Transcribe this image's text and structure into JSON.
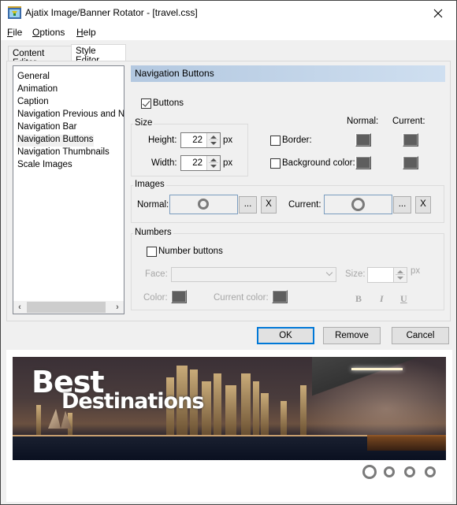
{
  "window": {
    "title": "Ajatix Image/Banner Rotator - [travel.css]",
    "close_icon": "close-x-icon"
  },
  "menu": {
    "items": [
      {
        "label": "File",
        "accel": "F",
        "rest": "ile"
      },
      {
        "label": "Options",
        "accel": "O",
        "rest": "ptions"
      },
      {
        "label": "Help",
        "accel": "H",
        "rest": "elp"
      }
    ]
  },
  "tabs": [
    {
      "label": "Content Editor",
      "active": false
    },
    {
      "label": "Style Editor",
      "active": true
    }
  ],
  "sidebar": {
    "items": [
      {
        "label": "General"
      },
      {
        "label": "Animation"
      },
      {
        "label": "Caption"
      },
      {
        "label": "Navigation Previous and Next"
      },
      {
        "label": "Navigation Bar"
      },
      {
        "label": "Navigation Buttons",
        "selected": true
      },
      {
        "label": "Navigation Thumbnails"
      },
      {
        "label": "Scale Images"
      }
    ],
    "scroll_left": "‹",
    "scroll_right": "›"
  },
  "section": {
    "title": "Navigation Buttons",
    "buttons_checkbox": {
      "label": "Buttons",
      "checked": true
    },
    "size_group": {
      "title": "Size",
      "height_label": "Height:",
      "height_value": "22",
      "width_label": "Width:",
      "width_value": "22",
      "unit": "px"
    },
    "colors": {
      "normal_header": "Normal:",
      "current_header": "Current:",
      "border": {
        "label": "Border:",
        "checked": false,
        "normal_color": "#5e5e5e",
        "current_color": "#5e5e5e"
      },
      "background": {
        "label": "Background color:",
        "checked": false,
        "normal_color": "#5e5e5e",
        "current_color": "#5e5e5e"
      }
    },
    "images_group": {
      "title": "Images",
      "normal_label": "Normal:",
      "current_label": "Current:",
      "browse_label": "...",
      "clear_label": "X"
    },
    "numbers_group": {
      "title": "Numbers",
      "number_buttons": {
        "label": "Number buttons",
        "checked": false
      },
      "face_label": "Face:",
      "face_value": "",
      "size_label": "Size:",
      "size_value": "",
      "size_unit": "px",
      "color_label": "Color:",
      "current_color_label": "Current color:",
      "color": "#5e5e5e",
      "current_color": "#5e5e5e",
      "bold_label": "B",
      "italic_label": "I",
      "underline_label": "U"
    }
  },
  "dialog_buttons": {
    "ok": "OK",
    "remove": "Remove",
    "cancel": "Cancel"
  },
  "preview": {
    "title_line1": "Best",
    "title_line2": "Destinations",
    "nav_buttons_count": 4,
    "current_index": 0
  }
}
